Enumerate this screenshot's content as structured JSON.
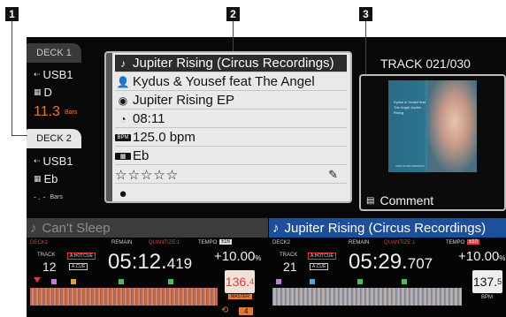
{
  "callouts": [
    "1",
    "2",
    "3"
  ],
  "deck_list": {
    "deck1": {
      "tab": "DECK 1",
      "source": "USB1",
      "key": "D",
      "bars_value": "11.3",
      "bars_unit": "Bars"
    },
    "deck2": {
      "tab": "DECK 2",
      "source": "USB1",
      "key": "Eb",
      "bars_value": "- . -",
      "bars_unit": "Bars"
    }
  },
  "track_info": {
    "title": "Jupiter Rising (Circus Recordings)",
    "artist": "Kydus & Yousef feat The Angel",
    "album": "Jupiter Rising EP",
    "duration": "08:11",
    "bpm": "125.0 bpm",
    "key": "Eb",
    "rating": "☆☆☆☆☆",
    "icons": [
      "note-icon",
      "artist-icon",
      "album-icon",
      "clock-icon",
      "bpm-icon",
      "key-icon",
      "pencil-icon",
      "color-dot-icon"
    ]
  },
  "track_counter": "TRACK 021/030",
  "artwork_text": {
    "lines": "Kydus & Yousef feat The Angel Jupiter Rising",
    "footer": "CIRCUS RECORDINGS"
  },
  "comment_label": "Comment",
  "left_deck": {
    "title": "Can't Sleep",
    "deck_label": "DECK1",
    "remain": "REMAIN",
    "quantize": "QUANTIZE:1",
    "tempo_label": "TEMPO",
    "tempo_range": "±16",
    "track_label": "TRACK",
    "track_num": "12",
    "hot_cue": "A.HOTCUE",
    "auto_cue": "A.CUE",
    "time_main": "05:12.",
    "time_ms": "419",
    "tempo_value": "+10.00",
    "tempo_pct": "%",
    "bpm_main": "136.",
    "bpm_dec": "4",
    "master": "MASTER",
    "loop_beats": "4"
  },
  "right_deck": {
    "title": "Jupiter Rising (Circus Recordings)",
    "deck_label": "DECK2",
    "remain": "REMAIN",
    "quantize": "QUANTIZE:1",
    "tempo_label": "TEMPO",
    "tempo_range": "±10",
    "track_label": "TRACK",
    "track_num": "21",
    "hot_cue": "A.HOTCUE",
    "auto_cue": "A.CUE",
    "time_main": "05:29.",
    "time_ms": "707",
    "tempo_value": "+10.00",
    "tempo_pct": "%",
    "bpm_main": "137.",
    "bpm_dec": "5",
    "bpm_unit": "BPM"
  },
  "colors": {
    "accent_orange": "#e27b2f",
    "deck2_blue": "#1d4f9a",
    "panel_bg": "#e9e9e9"
  }
}
